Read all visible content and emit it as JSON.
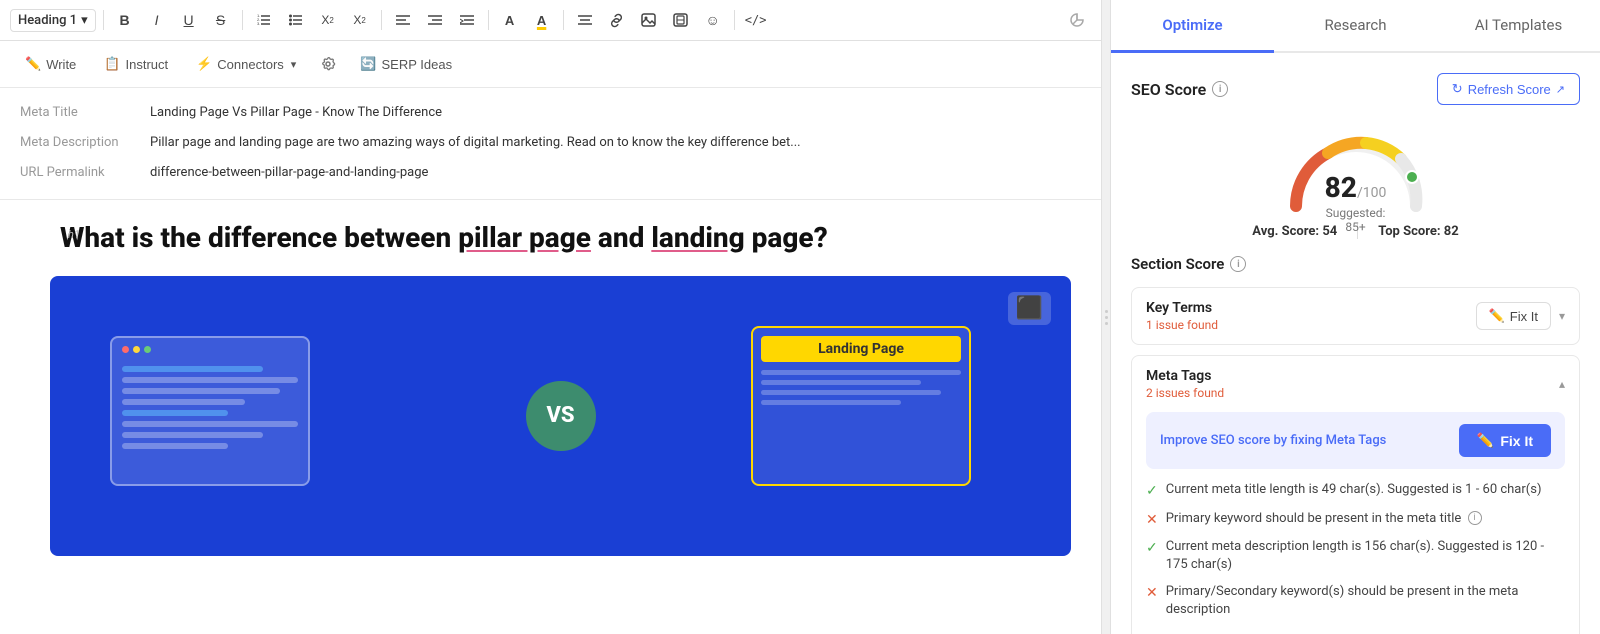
{
  "editor": {
    "heading_select": "Heading 1",
    "toolbar_buttons": [
      "B",
      "I",
      "U",
      "S"
    ],
    "sub_toolbar": {
      "write": "Write",
      "instruct": "Instruct",
      "connectors": "Connectors",
      "serp_ideas": "SERP Ideas"
    },
    "meta": {
      "title_label": "Meta Title",
      "title_value": "Landing Page Vs Pillar Page - Know The Difference",
      "description_label": "Meta Description",
      "description_value": "Pillar page and landing page are two amazing ways of digital marketing. Read on to know the key difference bet...",
      "url_label": "URL Permalink",
      "url_value": "difference-between-pillar-page-and-landing-page"
    },
    "h1_label": "h1",
    "img_label": "img",
    "article_title_part1": "What is the difference between ",
    "article_title_keyword1": "pillar page",
    "article_title_part2": " and ",
    "article_title_keyword2": "landing",
    "article_title_part3": " page?",
    "vs_text": "VS"
  },
  "right_panel": {
    "tabs": [
      {
        "id": "optimize",
        "label": "Optimize"
      },
      {
        "id": "research",
        "label": "Research"
      },
      {
        "id": "ai_templates",
        "label": "AI Templates"
      }
    ],
    "active_tab": "optimize",
    "seo_score": {
      "title": "SEO Score",
      "refresh_btn": "Refresh Score",
      "score": "82",
      "score_max": "/100",
      "suggested_label": "Suggested: 85+",
      "avg_label": "Avg. Score:",
      "avg_value": "54",
      "top_label": "Top Score:",
      "top_value": "82"
    },
    "section_score": {
      "title": "Section Score",
      "items": [
        {
          "title": "Key Terms",
          "issue_count": "1 issue found",
          "fix_it_label": "Fix It",
          "expanded": false
        },
        {
          "title": "Meta Tags",
          "issue_count": "2 issues found",
          "fix_it_label": "Fix It",
          "expanded": true,
          "banner_text": "Improve SEO score by fixing Meta Tags",
          "banner_fix_label": "Fix It",
          "checks": [
            {
              "ok": true,
              "text": "Current meta title length is 49 char(s). Suggested is 1 - 60 char(s)"
            },
            {
              "ok": false,
              "text": "Primary keyword should be present in the meta title",
              "has_info": true
            },
            {
              "ok": true,
              "text": "Current meta description length is 156 char(s). Suggested is 120 - 175 char(s)"
            },
            {
              "ok": false,
              "text": "Primary/Secondary keyword(s) should be present in the meta description"
            }
          ]
        }
      ]
    }
  }
}
